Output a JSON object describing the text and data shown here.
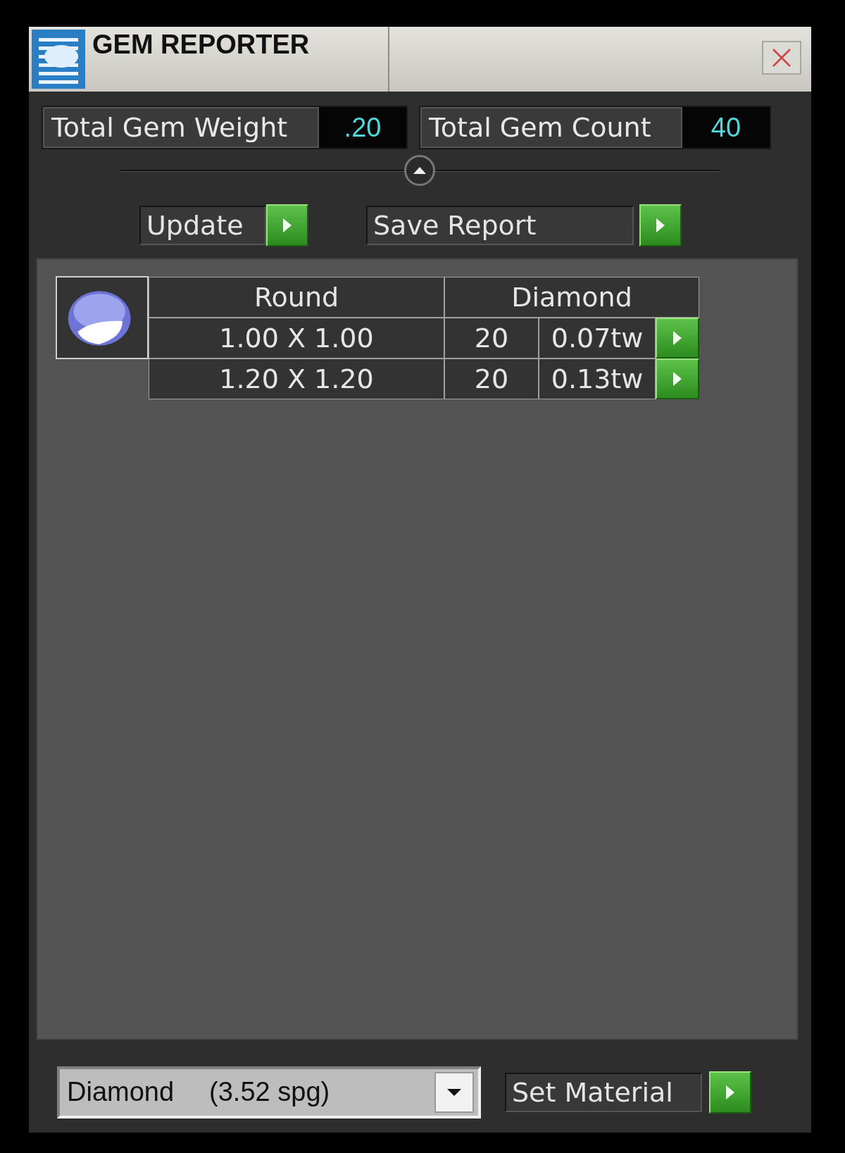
{
  "window": {
    "title": "GEM REPORTER"
  },
  "stats": [
    {
      "label": "Total Gem Weight",
      "value": ".20"
    },
    {
      "label": "Total Gem Count",
      "value": "40"
    }
  ],
  "actions": [
    {
      "label": "Update"
    },
    {
      "label": "Save Report"
    }
  ],
  "gem_table": {
    "shape": "Round",
    "material": "Diamond",
    "rows": [
      {
        "size": "1.00 X 1.00",
        "count": "20",
        "weight": "0.07tw"
      },
      {
        "size": "1.20 X 1.20",
        "count": "20",
        "weight": "0.13tw"
      }
    ]
  },
  "material_select": {
    "material": "Diamond",
    "density": "(3.52 spg)"
  },
  "set_material": {
    "label": "Set Material"
  }
}
